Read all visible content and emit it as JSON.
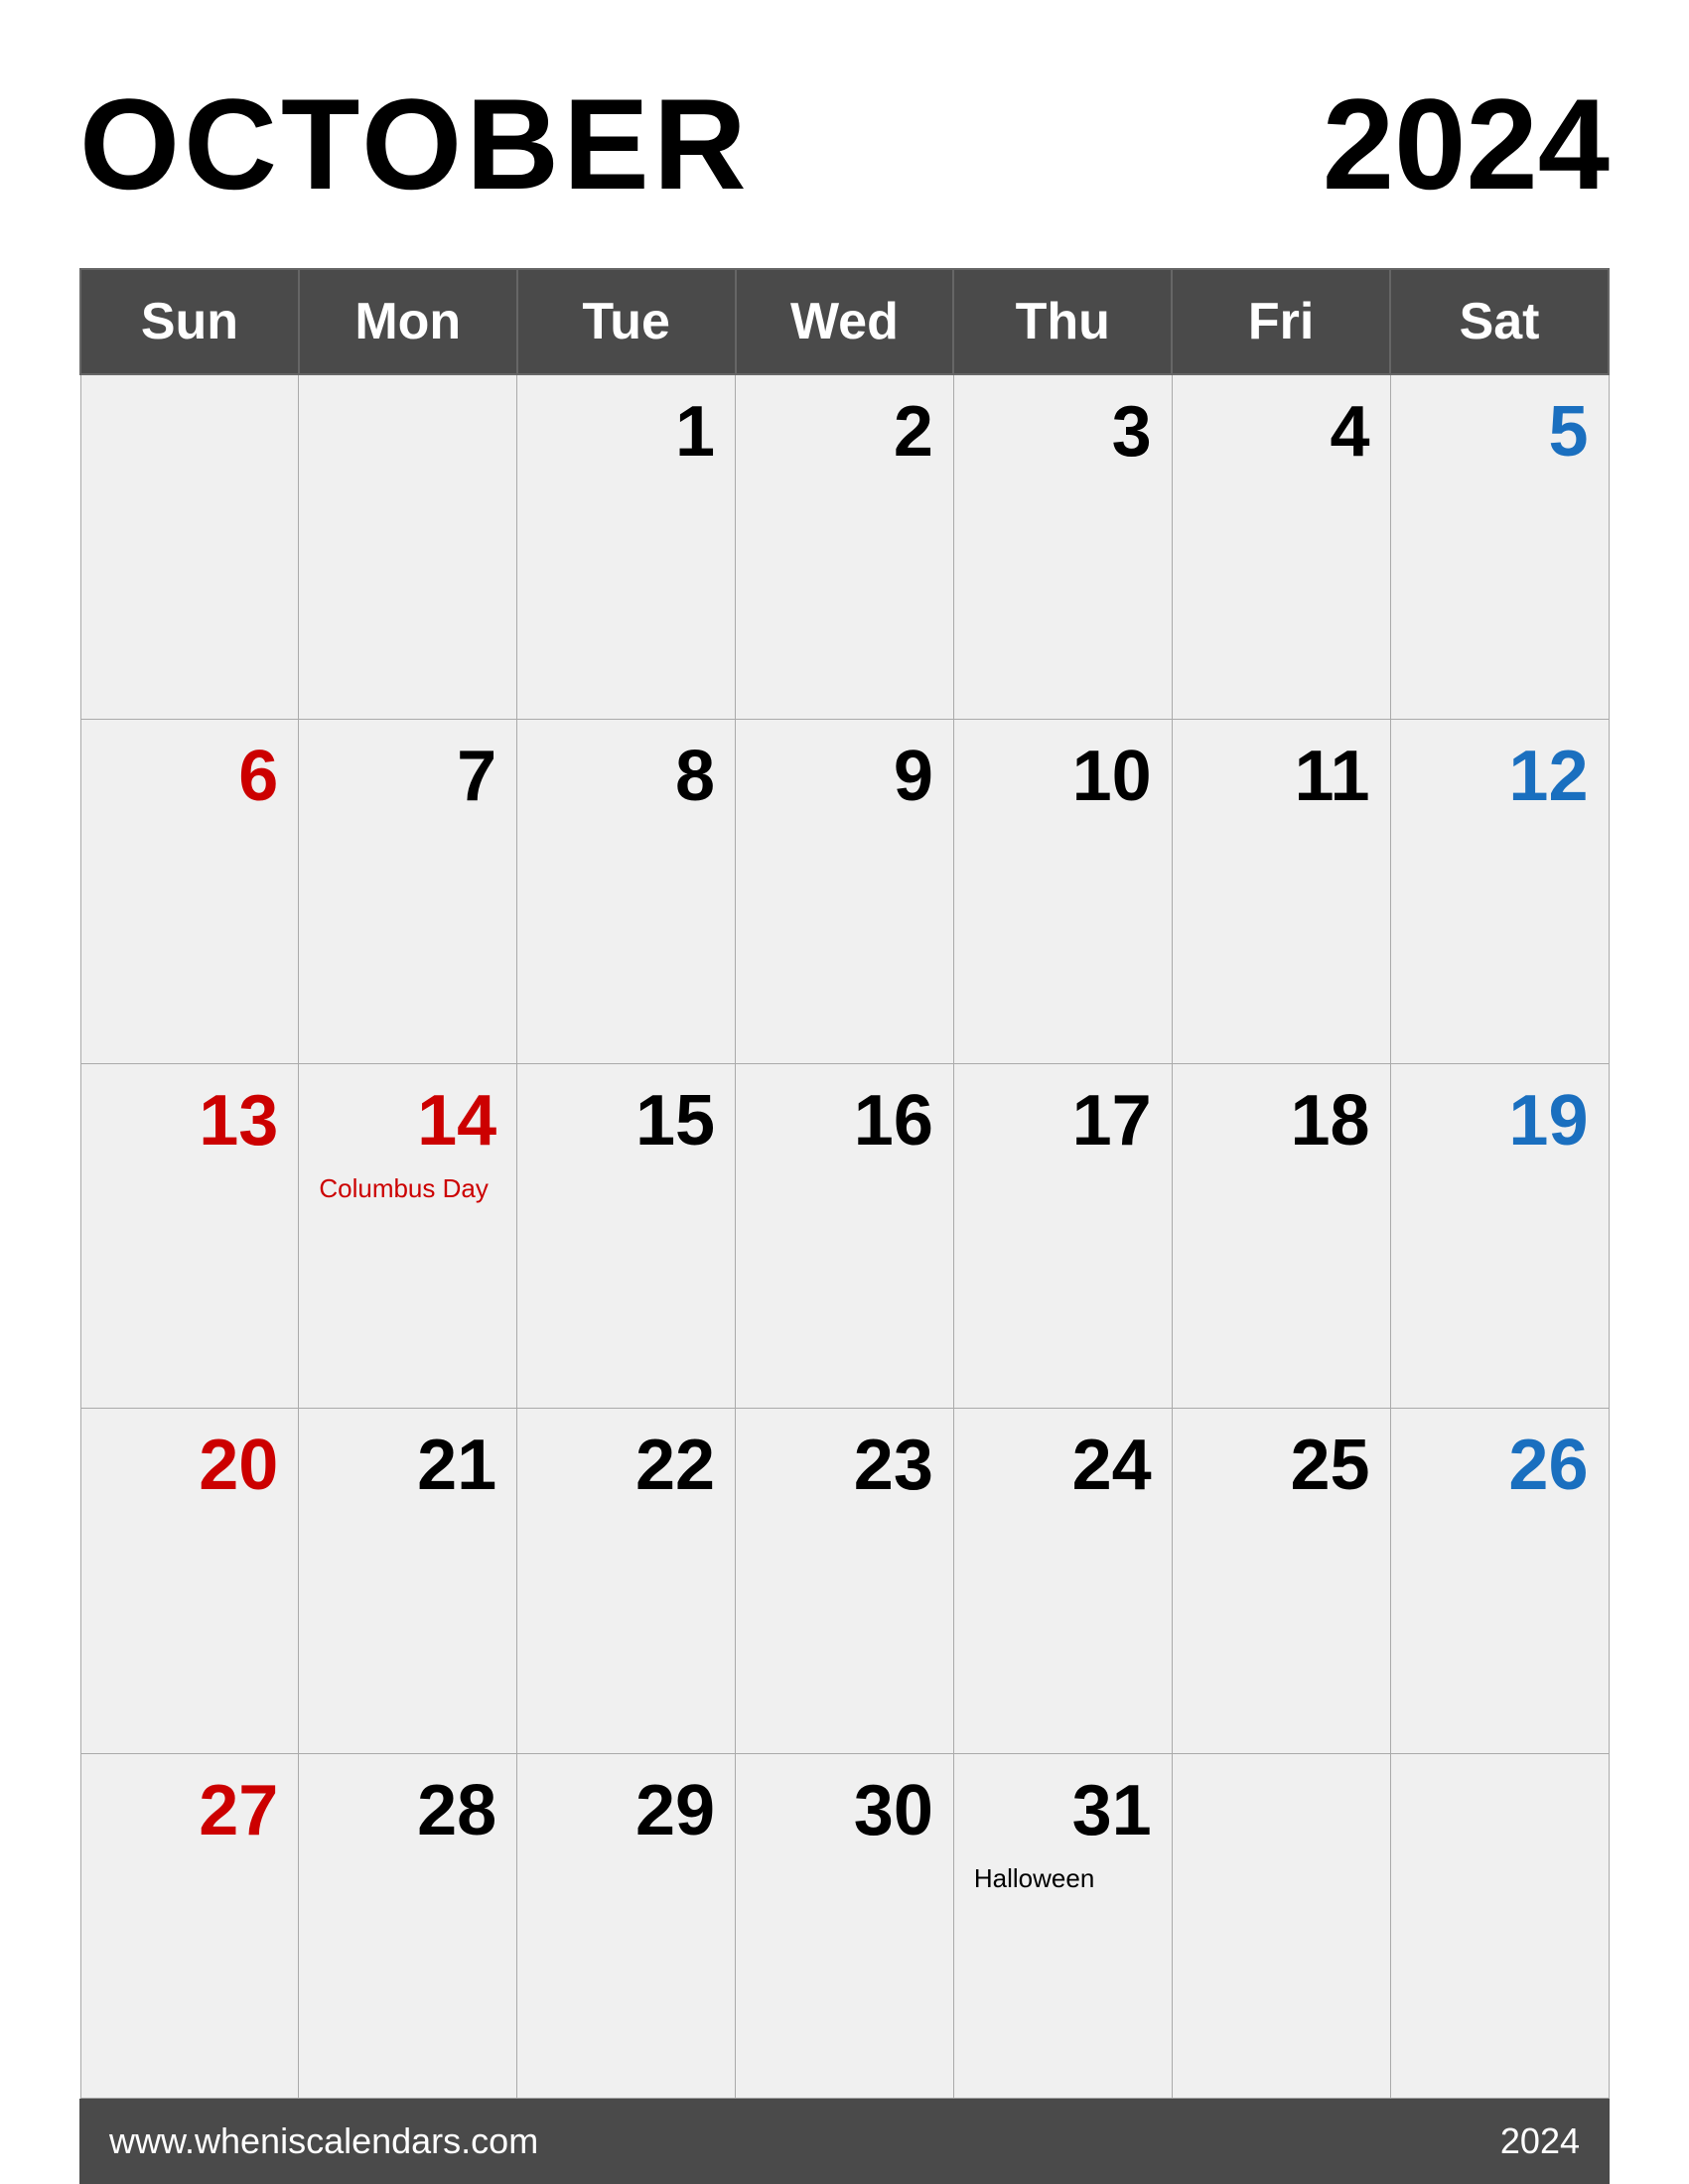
{
  "header": {
    "month": "OCTOBER",
    "year": "2024"
  },
  "days_of_week": [
    "Sun",
    "Mon",
    "Tue",
    "Wed",
    "Thu",
    "Fri",
    "Sat"
  ],
  "weeks": [
    [
      {
        "day": "",
        "color": "empty"
      },
      {
        "day": "",
        "color": "empty"
      },
      {
        "day": "1",
        "color": "black"
      },
      {
        "day": "2",
        "color": "black"
      },
      {
        "day": "3",
        "color": "black"
      },
      {
        "day": "4",
        "color": "black"
      },
      {
        "day": "5",
        "color": "blue"
      }
    ],
    [
      {
        "day": "6",
        "color": "red"
      },
      {
        "day": "7",
        "color": "black"
      },
      {
        "day": "8",
        "color": "black"
      },
      {
        "day": "9",
        "color": "black"
      },
      {
        "day": "10",
        "color": "black"
      },
      {
        "day": "11",
        "color": "black"
      },
      {
        "day": "12",
        "color": "blue"
      }
    ],
    [
      {
        "day": "13",
        "color": "red"
      },
      {
        "day": "14",
        "color": "red",
        "event": "Columbus Day"
      },
      {
        "day": "15",
        "color": "black"
      },
      {
        "day": "16",
        "color": "black"
      },
      {
        "day": "17",
        "color": "black"
      },
      {
        "day": "18",
        "color": "black"
      },
      {
        "day": "19",
        "color": "blue"
      }
    ],
    [
      {
        "day": "20",
        "color": "red"
      },
      {
        "day": "21",
        "color": "black"
      },
      {
        "day": "22",
        "color": "black"
      },
      {
        "day": "23",
        "color": "black"
      },
      {
        "day": "24",
        "color": "black"
      },
      {
        "day": "25",
        "color": "black"
      },
      {
        "day": "26",
        "color": "blue"
      }
    ],
    [
      {
        "day": "27",
        "color": "red"
      },
      {
        "day": "28",
        "color": "black"
      },
      {
        "day": "29",
        "color": "black"
      },
      {
        "day": "30",
        "color": "black"
      },
      {
        "day": "31",
        "color": "black",
        "event_black": "Halloween"
      },
      {
        "day": "",
        "color": "empty"
      },
      {
        "day": "",
        "color": "empty"
      }
    ]
  ],
  "footer": {
    "url": "www.wheniscalendars.com",
    "year": "2024"
  }
}
